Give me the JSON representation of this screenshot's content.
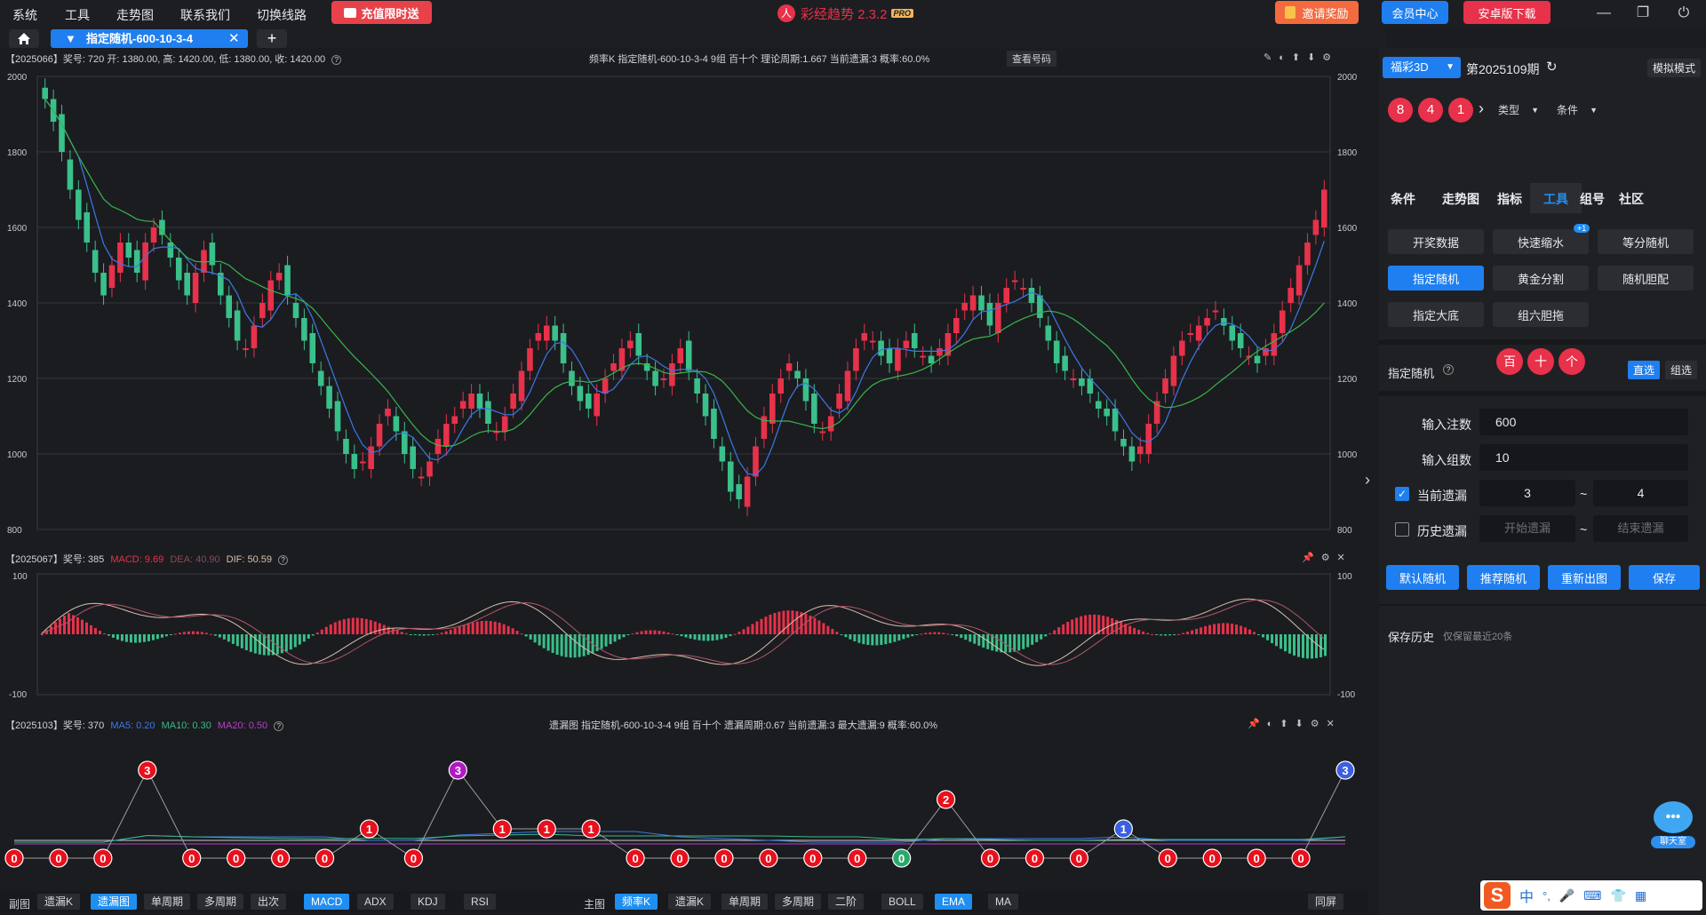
{
  "menu": [
    "系统",
    "工具",
    "走势图",
    "联系我们",
    "切换线路"
  ],
  "promo_recharge": "充值限时送",
  "app_title": "彩经趋势 2.3.2",
  "app_badge": "PRO",
  "invite_reward": "邀请奖励",
  "member_center": "会员中心",
  "android_download": "安卓版下载",
  "tab": {
    "label": "指定随机-600-10-3-4"
  },
  "main_chart": {
    "head_left": "【2025066】奖号: 720  开: 1380.00, 高: 1420.00, 低: 1380.00, 收: 1420.00",
    "head_center": "频率K   指定随机-600-10-3-4   9组   百十个   理论周期:1.667   当前遗漏:3   概率:60.0%",
    "head_btn": "查看号码",
    "y_ticks": [
      "2000",
      "1800",
      "1600",
      "1400",
      "1200",
      "1000",
      "800"
    ]
  },
  "macd_chart": {
    "head_prefix": "【2025067】奖号: 385",
    "macd": "MACD: 9.69",
    "dea": "DEA: 40.90",
    "dif": "DIF: 50.59",
    "y_ticks": [
      "100",
      "-100"
    ]
  },
  "miss_chart": {
    "head_prefix": "【2025103】奖号: 370",
    "ma5": "MA5: 0.20",
    "ma10": "MA10: 0.30",
    "ma20": "MA20: 0.50",
    "head_center": "遗漏图   指定随机-600-10-3-4   9组   百十个   遗漏周期:0.67   当前遗漏:3   最大遗漏:9   概率:60.0%"
  },
  "chart_data": [
    {
      "type": "candlestick",
      "title": "频率K",
      "ylim": [
        800,
        2000
      ],
      "y_ticks": [
        800,
        1000,
        1200,
        1400,
        1600,
        1800,
        2000
      ],
      "close_path": [
        1940,
        1880,
        1800,
        1700,
        1620,
        1560,
        1480,
        1420,
        1500,
        1560,
        1520,
        1480,
        1560,
        1600,
        1580,
        1520,
        1460,
        1420,
        1480,
        1540,
        1500,
        1420,
        1360,
        1300,
        1280,
        1340,
        1400,
        1460,
        1480,
        1420,
        1360,
        1300,
        1240,
        1180,
        1120,
        1060,
        1000,
        960,
        980,
        1020,
        1080,
        1120,
        1060,
        1000,
        960,
        940,
        980,
        1040,
        1080,
        1100,
        1140,
        1160,
        1120,
        1080,
        1060,
        1100,
        1160,
        1220,
        1280,
        1320,
        1340,
        1300,
        1240,
        1180,
        1140,
        1120,
        1160,
        1200,
        1240,
        1280,
        1300,
        1260,
        1220,
        1180,
        1200,
        1240,
        1280,
        1220,
        1160,
        1100,
        1040,
        980,
        900,
        880,
        940,
        1020,
        1100,
        1160,
        1200,
        1240,
        1200,
        1140,
        1080,
        1060,
        1100,
        1160,
        1220,
        1280,
        1320,
        1300,
        1260,
        1240,
        1280,
        1300,
        1280,
        1260,
        1240,
        1280,
        1320,
        1360,
        1400,
        1420,
        1380,
        1340,
        1400,
        1440,
        1460,
        1440,
        1400,
        1360,
        1300,
        1240,
        1220,
        1200,
        1180,
        1160,
        1120,
        1100,
        1060,
        1020,
        980,
        1020,
        1080,
        1140,
        1200,
        1260,
        1300,
        1320,
        1340,
        1360,
        1380,
        1340,
        1300,
        1280,
        1260,
        1240,
        1280,
        1320,
        1380,
        1440,
        1500,
        1560,
        1620,
        1700
      ],
      "ma_fast": "blue",
      "ma_slow": "green"
    },
    {
      "type": "macd",
      "ylim": [
        -100,
        100
      ],
      "MACD": 9.69,
      "DEA": 40.9,
      "DIF": 50.59
    },
    {
      "type": "line",
      "title": "遗漏图",
      "points": [
        0,
        0,
        0,
        3,
        0,
        0,
        0,
        0,
        1,
        0,
        3,
        1,
        1,
        1,
        0,
        0,
        0,
        0,
        0,
        0,
        0,
        2,
        0,
        0,
        0,
        1,
        0,
        0,
        0,
        0,
        3
      ],
      "MA5": 0.2,
      "MA10": 0.3,
      "MA20": 0.5
    }
  ],
  "bottom_left_label": "副图",
  "bottom_left": [
    "遗漏K",
    "遗漏图",
    "单周期",
    "多周期",
    "出次",
    "MACD",
    "ADX",
    "KDJ",
    "RSI"
  ],
  "bottom_main_label": "主图",
  "bottom_main": [
    "频率K",
    "遗漏K",
    "单周期",
    "多周期",
    "二阶",
    "BOLL",
    "EMA",
    "MA"
  ],
  "bottom_right": "同屏",
  "right": {
    "lottery": "福彩3D",
    "period": "第2025109期",
    "mode": "模拟模式",
    "balls": [
      "8",
      "4",
      "1"
    ],
    "type_dd": "类型",
    "cond_dd": "条件",
    "tabs": [
      "条件",
      "走势图",
      "指标",
      "工具",
      "组号",
      "社区"
    ],
    "tools": [
      "开奖数据",
      "快速缩水",
      "等分随机",
      "指定随机",
      "黄金分割",
      "随机胆配",
      "指定大底",
      "组六胆拖"
    ],
    "badge": "+1",
    "section_title": "指定随机",
    "direct": "直选",
    "group": "组选",
    "positions": [
      "百",
      "十",
      "个"
    ],
    "label_notes": "输入注数",
    "notes": "600",
    "label_groups": "输入组数",
    "groups": "10",
    "label_cur_miss": "当前遗漏",
    "cur_miss_from": "3",
    "cur_miss_to": "4",
    "label_hist_miss": "历史遗漏",
    "hist_from_ph": "开始遗漏",
    "hist_to_ph": "结束遗漏",
    "tilde": "~",
    "actions": [
      "默认随机",
      "推荐随机",
      "重新出图",
      "保存"
    ],
    "history_title": "保存历史",
    "history_note": "仅保留最近20条",
    "chat": "聊天室"
  },
  "ime": [
    "中",
    "°,",
    "🎤",
    "⌨",
    "👕",
    "▦"
  ]
}
